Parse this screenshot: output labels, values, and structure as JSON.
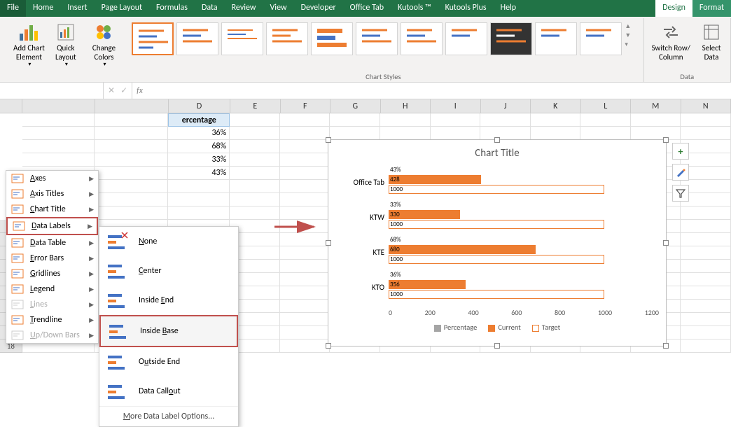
{
  "tabs": {
    "file": "File",
    "home": "Home",
    "insert": "Insert",
    "pagelayout": "Page Layout",
    "formulas": "Formulas",
    "data": "Data",
    "review": "Review",
    "view": "View",
    "developer": "Developer",
    "officetab": "Office Tab",
    "kutools": "Kutools ™",
    "kutoolsplus": "Kutools Plus",
    "help": "Help",
    "design": "Design",
    "format": "Format"
  },
  "ribbon": {
    "add_chart_element": "Add Chart\nElement",
    "quick_layout": "Quick\nLayout",
    "change_colors": "Change\nColors",
    "chart_styles": "Chart Styles",
    "switch": "Switch Row/\nColumn",
    "select_data": "Select\nData",
    "data_group": "Data"
  },
  "menu1": [
    {
      "label": "Axes",
      "disabled": false
    },
    {
      "label": "Axis Titles",
      "disabled": false
    },
    {
      "label": "Chart Title",
      "disabled": false
    },
    {
      "label": "Data Labels",
      "disabled": false,
      "highlight": true
    },
    {
      "label": "Data Table",
      "disabled": false
    },
    {
      "label": "Error Bars",
      "disabled": false
    },
    {
      "label": "Gridlines",
      "disabled": false
    },
    {
      "label": "Legend",
      "disabled": false
    },
    {
      "label": "Lines",
      "disabled": true
    },
    {
      "label": "Trendline",
      "disabled": false
    },
    {
      "label": "Up/Down Bars",
      "disabled": true
    }
  ],
  "menu2": [
    {
      "label": "None"
    },
    {
      "label": "Center"
    },
    {
      "label": "Inside End"
    },
    {
      "label": "Inside Base",
      "highlight": true
    },
    {
      "label": "Outside End"
    },
    {
      "label": "Data Callout"
    }
  ],
  "menu2_more": "More Data Label Options...",
  "sheet": {
    "header_ercentage": "ercentage",
    "rows": [
      {
        "pct": "36%"
      },
      {
        "pct": "68%"
      },
      {
        "pct": "33%"
      },
      {
        "pct": "43%"
      }
    ]
  },
  "chart_data": {
    "type": "bar",
    "title": "Chart Title",
    "categories": [
      "Office Tab",
      "KTW",
      "KTE",
      "KTO"
    ],
    "series": [
      {
        "name": "Percentage",
        "values": [
          0.43,
          0.33,
          0.68,
          0.36
        ],
        "labels": [
          "43%",
          "33%",
          "68%",
          "36%"
        ]
      },
      {
        "name": "Current",
        "values": [
          428,
          330,
          680,
          356
        ]
      },
      {
        "name": "Target",
        "values": [
          1000,
          1000,
          1000,
          1000
        ]
      }
    ],
    "xlim": [
      0,
      1200
    ],
    "xticks": [
      0,
      200,
      400,
      600,
      800,
      1000,
      1200
    ],
    "legend": [
      "Percentage",
      "Current",
      "Target"
    ]
  },
  "colors": {
    "accent": "#ed7d31",
    "excel": "#217346",
    "gray": "#a5a5a5"
  }
}
